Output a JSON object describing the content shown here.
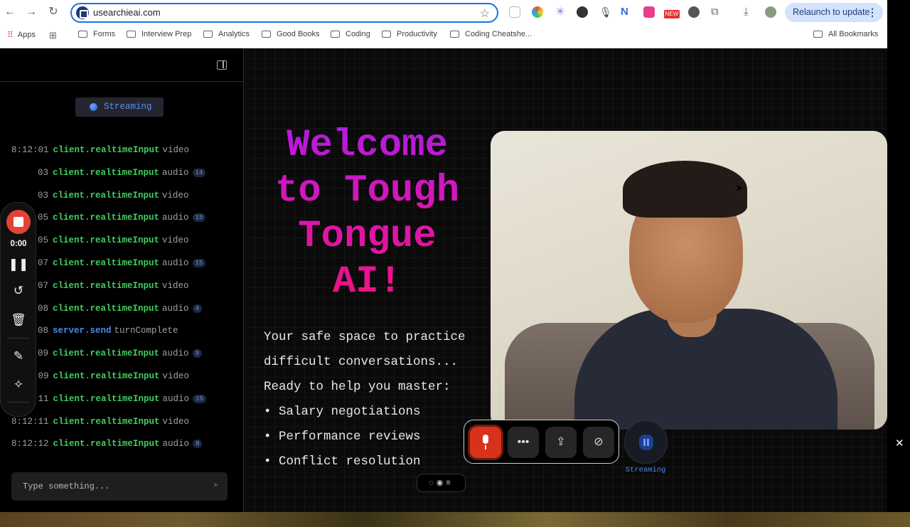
{
  "browser": {
    "url": "usearchieai.com",
    "relaunch_label": "Relaunch to update",
    "new_badge": "NEW"
  },
  "bookmarks": {
    "apps": "Apps",
    "items": [
      "Forms",
      "Interview Prep",
      "Analytics",
      "Good Books",
      "Coding",
      "Productivity",
      "Coding Cheatshe..."
    ],
    "all": "All Bookmarks"
  },
  "sidebar": {
    "status": "Streaming",
    "input_placeholder": "Type something...",
    "logs": [
      {
        "time": "8:12:01",
        "fn": "client.realtimeInput",
        "kind": "video",
        "count": ""
      },
      {
        "time": "03",
        "fn": "client.realtimeInput",
        "kind": "audio",
        "count": "14"
      },
      {
        "time": "03",
        "fn": "client.realtimeInput",
        "kind": "video",
        "count": ""
      },
      {
        "time": "05",
        "fn": "client.realtimeInput",
        "kind": "audio",
        "count": "15"
      },
      {
        "time": "05",
        "fn": "client.realtimeInput",
        "kind": "video",
        "count": ""
      },
      {
        "time": "07",
        "fn": "client.realtimeInput",
        "kind": "audio",
        "count": "15"
      },
      {
        "time": "07",
        "fn": "client.realtimeInput",
        "kind": "video",
        "count": ""
      },
      {
        "time": "08",
        "fn": "client.realtimeInput",
        "kind": "audio",
        "count": "4"
      },
      {
        "time": "08",
        "fn": "server.send",
        "kind": "turnComplete",
        "count": ""
      },
      {
        "time": "09",
        "fn": "client.realtimeInput",
        "kind": "audio",
        "count": "9"
      },
      {
        "time": "8:12:09",
        "fn": "client.realtimeInput",
        "kind": "video",
        "count": ""
      },
      {
        "time": "8:12:11",
        "fn": "client.realtimeInput",
        "kind": "audio",
        "count": "15"
      },
      {
        "time": "8:12:11",
        "fn": "client.realtimeInput",
        "kind": "video",
        "count": ""
      },
      {
        "time": "8:12:12",
        "fn": "client.realtimeInput",
        "kind": "audio",
        "count": "8"
      }
    ]
  },
  "recorder": {
    "time": "0:00"
  },
  "main": {
    "welcome": "Welcome to Tough Tongue AI!",
    "lines": [
      "Your safe space to practice",
      "difficult conversations...",
      "Ready to help you master:",
      "• Salary negotiations",
      "• Performance reviews",
      "• Conflict resolution"
    ],
    "stream_label": "Streaming"
  },
  "colors": {
    "accent": "#1a73e8",
    "record": "#e24335",
    "client_fn": "#3ecf5e",
    "server_fn": "#4d8ae8",
    "title_start": "#b01be3",
    "title_end": "#f0127d"
  }
}
